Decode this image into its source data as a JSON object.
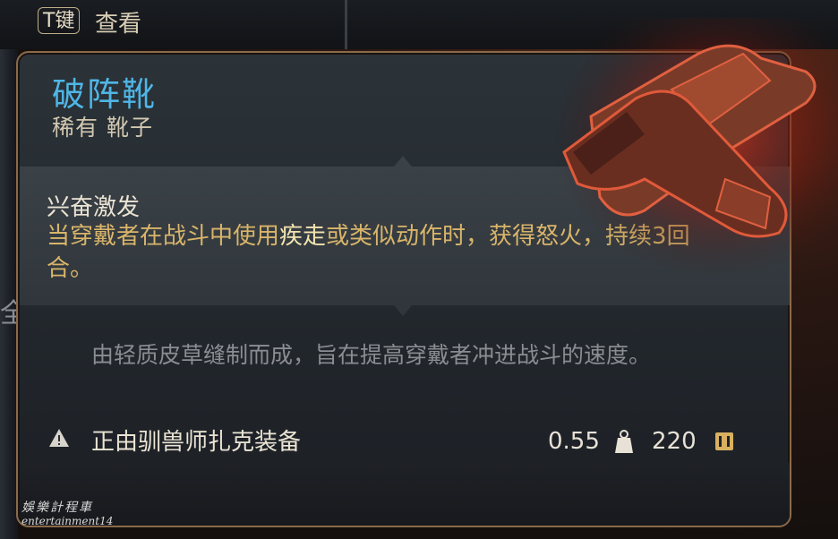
{
  "hud": {
    "key_label": "T键",
    "action_label": "查看",
    "edge_glyph": "全"
  },
  "item": {
    "name": "破阵靴",
    "subtitle": "稀有 靴子",
    "effect_name": "兴奋激发",
    "effect_desc_before": "当穿戴者在战斗中使用",
    "effect_desc_highlight": "疾走",
    "effect_desc_after": "或类似动作时，获得怒火，持续3回合。",
    "flavor_text": "由轻质皮草缝制而成，旨在提高穿戴者冲进战斗的速度。",
    "equipped_by": "正由驯兽师扎克装备",
    "weight": "0.55",
    "price": "220"
  },
  "icons": [
    "warning-icon",
    "weight-icon",
    "gold-coin-icon"
  ],
  "colors": {
    "title": "#4fb6e6",
    "effect_desc": "#d9b56a",
    "highlight": "#f2e3b0",
    "flavor": "#8a8d92",
    "border": "#8a6a4a"
  },
  "watermark": {
    "line1": "娛樂計程車",
    "line2": "entertainment14"
  }
}
